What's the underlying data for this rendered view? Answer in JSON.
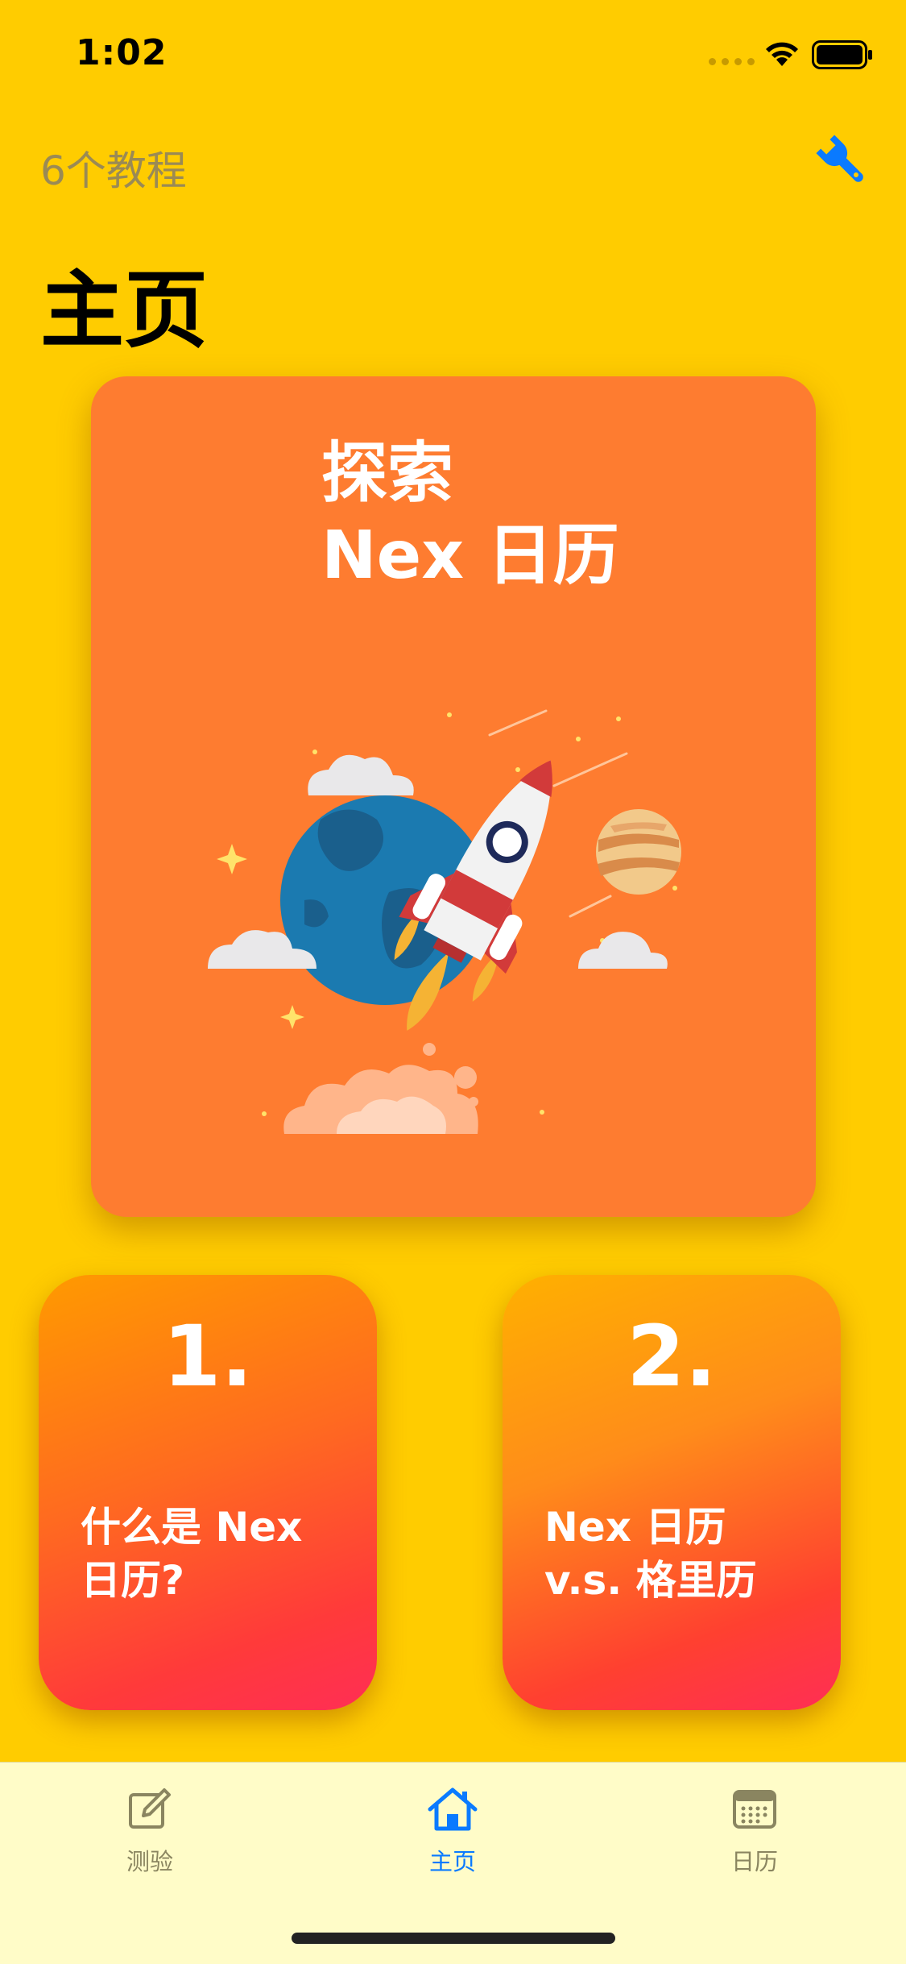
{
  "status_bar": {
    "time": "1:02"
  },
  "header": {
    "tutorial_count": "6个教程",
    "wrench_icon": "wrench-icon"
  },
  "page": {
    "title": "主页"
  },
  "hero": {
    "line1": "探索",
    "line2": "Nex 日历",
    "illustration": "rocket-launch-illustration"
  },
  "tutorials": [
    {
      "number": "1.",
      "title": "什么是 Nex 日历?"
    },
    {
      "number": "2.",
      "title": "Nex 日历 v.s. 格里历"
    }
  ],
  "tabs": [
    {
      "label": "测验",
      "icon": "compose-icon",
      "active": false
    },
    {
      "label": "主页",
      "icon": "house-icon",
      "active": true
    },
    {
      "label": "日历",
      "icon": "calendar-icon",
      "active": false
    }
  ],
  "colors": {
    "background": "#FFCC00",
    "hero_card": "#FE7C30",
    "accent": "#0A7AFF",
    "tab_bar": "#FFFCC8"
  }
}
